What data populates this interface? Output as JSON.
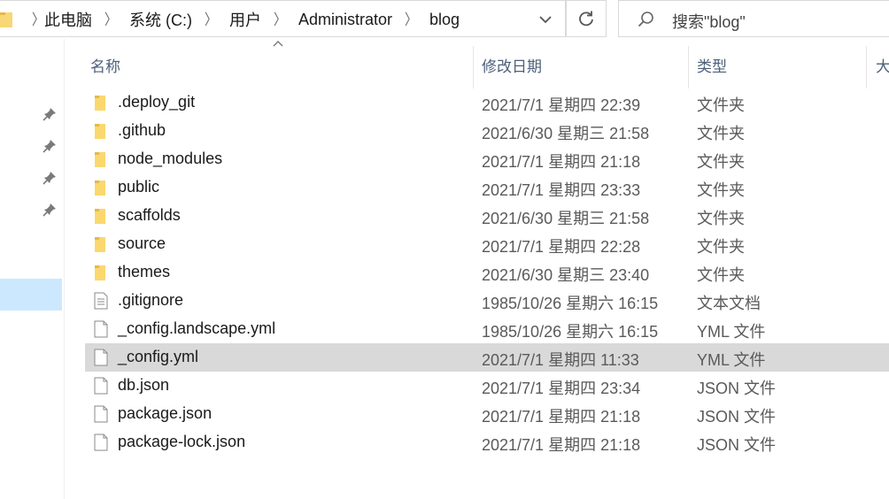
{
  "address_bar": {
    "crumbs": [
      "此电脑",
      "系统 (C:)",
      "用户",
      "Administrator",
      "blog"
    ]
  },
  "search": {
    "placeholder": "搜索\"blog\""
  },
  "columns": {
    "name": "名称",
    "date": "修改日期",
    "type": "类型",
    "size": "大"
  },
  "files": [
    {
      "name": ".deploy_git",
      "date": "2021/7/1 星期四 22:39",
      "type": "文件夹",
      "icon": "folder-icon"
    },
    {
      "name": ".github",
      "date": "2021/6/30 星期三 21:58",
      "type": "文件夹",
      "icon": "folder-icon"
    },
    {
      "name": "node_modules",
      "date": "2021/7/1 星期四 21:18",
      "type": "文件夹",
      "icon": "folder-icon"
    },
    {
      "name": "public",
      "date": "2021/7/1 星期四 23:33",
      "type": "文件夹",
      "icon": "folder-icon"
    },
    {
      "name": "scaffolds",
      "date": "2021/6/30 星期三 21:58",
      "type": "文件夹",
      "icon": "folder-icon"
    },
    {
      "name": "source",
      "date": "2021/7/1 星期四 22:28",
      "type": "文件夹",
      "icon": "folder-icon"
    },
    {
      "name": "themes",
      "date": "2021/6/30 星期三 23:40",
      "type": "文件夹",
      "icon": "folder-icon"
    },
    {
      "name": ".gitignore",
      "date": "1985/10/26 星期六 16:15",
      "type": "文本文档",
      "icon": "text-file-icon"
    },
    {
      "name": "_config.landscape.yml",
      "date": "1985/10/26 星期六 16:15",
      "type": "YML 文件",
      "icon": "file-icon"
    },
    {
      "name": "_config.yml",
      "date": "2021/7/1 星期四 11:33",
      "type": "YML 文件",
      "icon": "file-icon",
      "selected": true
    },
    {
      "name": "db.json",
      "date": "2021/7/1 星期四 23:34",
      "type": "JSON 文件",
      "icon": "file-icon"
    },
    {
      "name": "package.json",
      "date": "2021/7/1 星期四 21:18",
      "type": "JSON 文件",
      "icon": "file-icon"
    },
    {
      "name": "package-lock.json",
      "date": "2021/7/1 星期四 21:18",
      "type": "JSON 文件",
      "icon": "file-icon"
    }
  ],
  "colors": {
    "selected_row": "#d9d9d9",
    "nav_selected": "#cce8ff",
    "folder": "#f8d775"
  }
}
